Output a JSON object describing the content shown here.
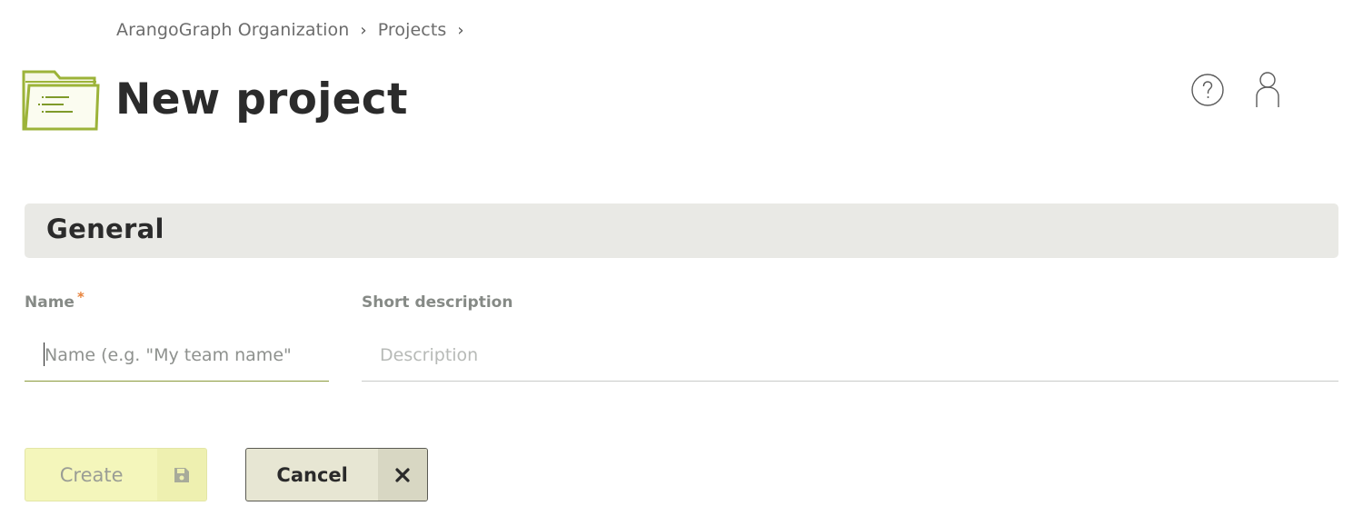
{
  "breadcrumb": {
    "items": [
      "ArangoGraph Organization",
      "Projects"
    ],
    "separator": "›"
  },
  "page": {
    "title": "New project",
    "icon": "folder-icon"
  },
  "header_actions": {
    "help_icon": "help-icon",
    "user_icon": "user-icon"
  },
  "section": {
    "title": "General"
  },
  "form": {
    "name_label": "Name",
    "name_required_mark": "*",
    "name_placeholder": "Name (e.g. \"My team name\"",
    "name_value": "",
    "description_label": "Short description",
    "description_placeholder": "Description",
    "description_value": ""
  },
  "buttons": {
    "create_label": "Create",
    "create_icon": "save-icon",
    "cancel_label": "Cancel",
    "cancel_icon": "close-icon"
  },
  "colors": {
    "accent": "#8a9a3a",
    "required": "#e8823a",
    "section_bg": "#e9e9e5",
    "create_bg": "#f4f6bb",
    "cancel_bg": "#e7e6d3"
  }
}
